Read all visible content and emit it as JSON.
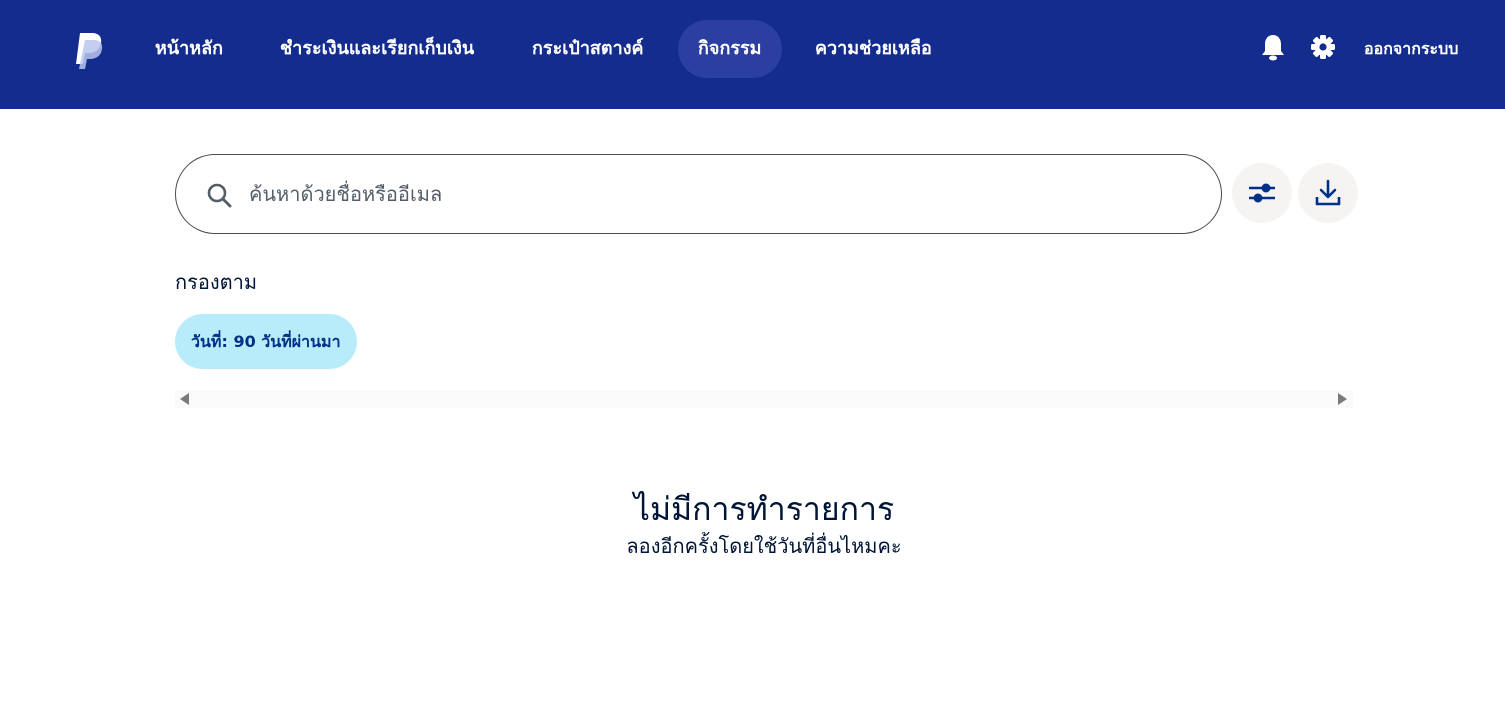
{
  "header": {
    "logo_icon": "paypal-logo",
    "nav": [
      {
        "label": "หน้าหลัก"
      },
      {
        "label": "ชำระเงินและเรียกเก็บเงิน"
      },
      {
        "label": "กระเป๋าสตางค์"
      },
      {
        "label": "กิจกรรม",
        "active": true
      },
      {
        "label": "ความช่วยเหลือ"
      }
    ],
    "bell_icon": "bell-icon",
    "settings_icon": "gear-icon",
    "logout_label": "ออกจากระบบ"
  },
  "search": {
    "placeholder": "ค้นหาด้วยชื่อหรืออีเมล",
    "value": "",
    "icon": "search-icon"
  },
  "actions": {
    "filter_icon": "sliders-icon",
    "download_icon": "download-icon"
  },
  "filters": {
    "label": "กรองตาม",
    "chips": [
      {
        "label": "วันที่: 90 วันที่ผ่านมา"
      }
    ]
  },
  "empty_state": {
    "title": "ไม่มีการทำรายการ",
    "subtitle": "ลองอีกครั้งโดยใช้วันที่อื่นไหมคะ"
  },
  "colors": {
    "header_bg": "#142c8e",
    "active_nav_bg": "#2a3fa0",
    "chip_bg": "#b9ecfb",
    "chip_text": "#003087",
    "icon_blue": "#003087",
    "text": "#001435"
  }
}
